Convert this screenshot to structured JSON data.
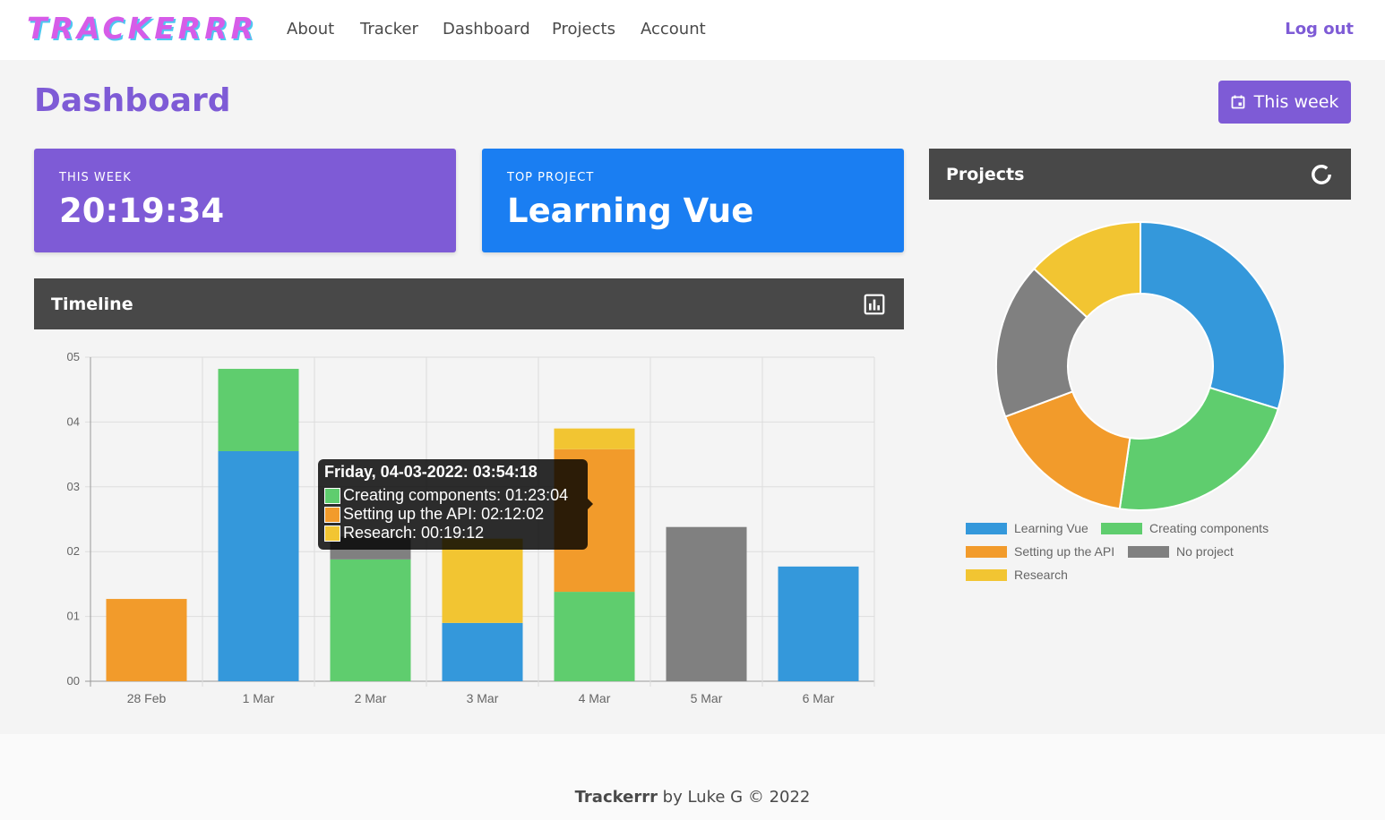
{
  "brand": "TRACKERRR",
  "nav": [
    "About",
    "Tracker",
    "Dashboard",
    "Projects",
    "Account"
  ],
  "logout": "Log out",
  "page_title": "Dashboard",
  "week_button": "This week",
  "stats": {
    "this_week_label": "This week",
    "this_week_value": "20:19:34",
    "top_project_label": "Top project",
    "top_project_value": "Learning Vue"
  },
  "timeline_title": "Timeline",
  "projects_title": "Projects",
  "colors": {
    "purple": "#7e5bd6",
    "blue": "#1a7ef2",
    "learning_vue": "#3498db",
    "creating_components": "#5fcd6e",
    "setting_up_api": "#f29b2b",
    "no_project": "#808080",
    "research": "#f2c532"
  },
  "tooltip": {
    "title": "Friday, 04-03-2022: 03:54:18",
    "rows": [
      {
        "text": "Creating components: 01:23:04",
        "color": "#5fcd6e"
      },
      {
        "text": "Setting up the API: 02:12:02",
        "color": "#f29b2b"
      },
      {
        "text": "Research: 00:19:12",
        "color": "#f2c532"
      }
    ]
  },
  "legend": [
    {
      "label": "Learning Vue",
      "color": "#3498db"
    },
    {
      "label": "Creating components",
      "color": "#5fcd6e"
    },
    {
      "label": "Setting up the API",
      "color": "#f29b2b"
    },
    {
      "label": "No project",
      "color": "#808080"
    },
    {
      "label": "Research",
      "color": "#f2c532"
    }
  ],
  "footer": {
    "brand": "Trackerrr",
    "rest": " by Luke G © 2022"
  },
  "chart_data": [
    {
      "type": "bar",
      "stacked": true,
      "categories": [
        "28 Feb",
        "1 Mar",
        "2 Mar",
        "3 Mar",
        "4 Mar",
        "5 Mar",
        "6 Mar"
      ],
      "ytick_labels": [
        "00",
        "01",
        "02",
        "03",
        "04",
        "05"
      ],
      "ylim": [
        0,
        5
      ],
      "grid": true,
      "series": [
        {
          "name": "Learning Vue",
          "color": "#3498db",
          "values": [
            0,
            3.55,
            0,
            0.9,
            0,
            0,
            1.77
          ]
        },
        {
          "name": "Creating components",
          "color": "#5fcd6e",
          "values": [
            0,
            1.27,
            1.88,
            0,
            1.38,
            0,
            0
          ]
        },
        {
          "name": "Setting up the API",
          "color": "#f29b2b",
          "values": [
            1.27,
            0,
            0,
            0,
            2.2,
            0,
            0
          ]
        },
        {
          "name": "No project",
          "color": "#808080",
          "values": [
            0,
            0,
            0.35,
            0,
            0,
            2.38,
            0
          ]
        },
        {
          "name": "Research",
          "color": "#f2c532",
          "values": [
            0,
            0,
            0,
            1.3,
            0.32,
            0,
            0
          ]
        }
      ]
    },
    {
      "type": "pie",
      "donut": true,
      "labels": [
        "Learning Vue",
        "Creating components",
        "Setting up the API",
        "No project",
        "Research"
      ],
      "values": [
        29.8,
        22.5,
        17.0,
        17.5,
        13.2
      ],
      "colors": [
        "#3498db",
        "#5fcd6e",
        "#f29b2b",
        "#808080",
        "#f2c532"
      ]
    }
  ]
}
